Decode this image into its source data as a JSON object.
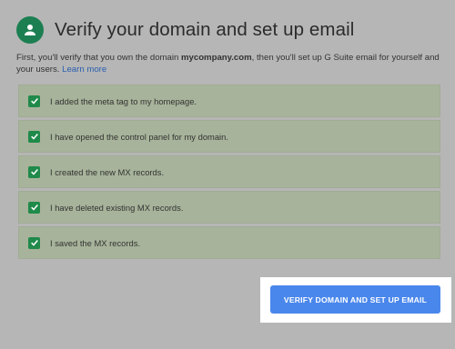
{
  "header": {
    "title": "Verify your domain and set up email",
    "avatar_icon": "person-icon",
    "avatar_color": "#1c7f52"
  },
  "intro": {
    "text_before": "First, you'll verify that you own the domain ",
    "domain": "mycompany.com",
    "text_after": ", then you'll set up G Suite email for yourself and your users. ",
    "learn_more": "Learn more"
  },
  "checklist": {
    "checked_icon": "check-icon",
    "checked_color": "#1f8a4a",
    "items": [
      {
        "label": "I added the meta tag to my homepage.",
        "checked": true
      },
      {
        "label": "I have opened the control panel for my domain.",
        "checked": true
      },
      {
        "label": "I created the new MX records.",
        "checked": true
      },
      {
        "label": "I have deleted existing MX records.",
        "checked": true
      },
      {
        "label": "I saved the MX records.",
        "checked": true
      }
    ]
  },
  "actions": {
    "verify_label": "VERIFY DOMAIN AND SET UP EMAIL",
    "verify_color": "#4a87ec"
  }
}
